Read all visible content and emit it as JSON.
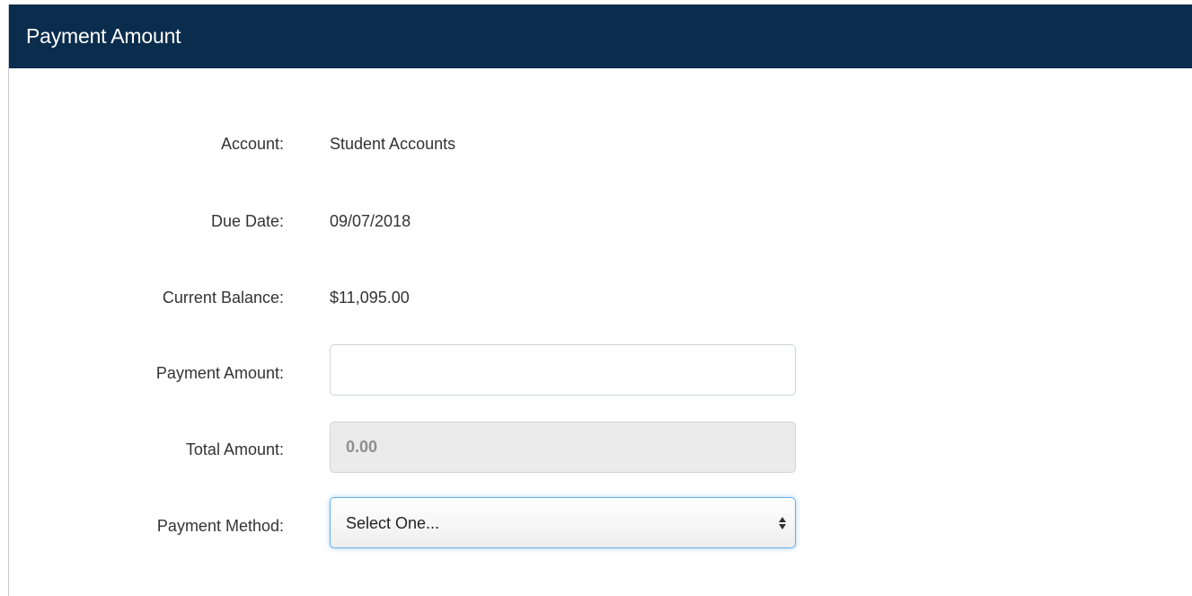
{
  "header": {
    "title": "Payment Amount"
  },
  "form": {
    "account": {
      "label": "Account:",
      "value": "Student Accounts"
    },
    "due_date": {
      "label": "Due Date:",
      "value": "09/07/2018"
    },
    "current_balance": {
      "label": "Current Balance:",
      "value": "$11,095.00"
    },
    "payment_amount": {
      "label": "Payment Amount:",
      "value": "",
      "placeholder": ""
    },
    "total_amount": {
      "label": "Total Amount:",
      "value": "0.00"
    },
    "payment_method": {
      "label": "Payment Method:",
      "selected": "Select One...",
      "icon": "select-arrows-icon"
    }
  },
  "colors": {
    "header_bg": "#0b2d4d",
    "focus_border": "#66afe9",
    "readonly_bg": "#ebebeb"
  }
}
